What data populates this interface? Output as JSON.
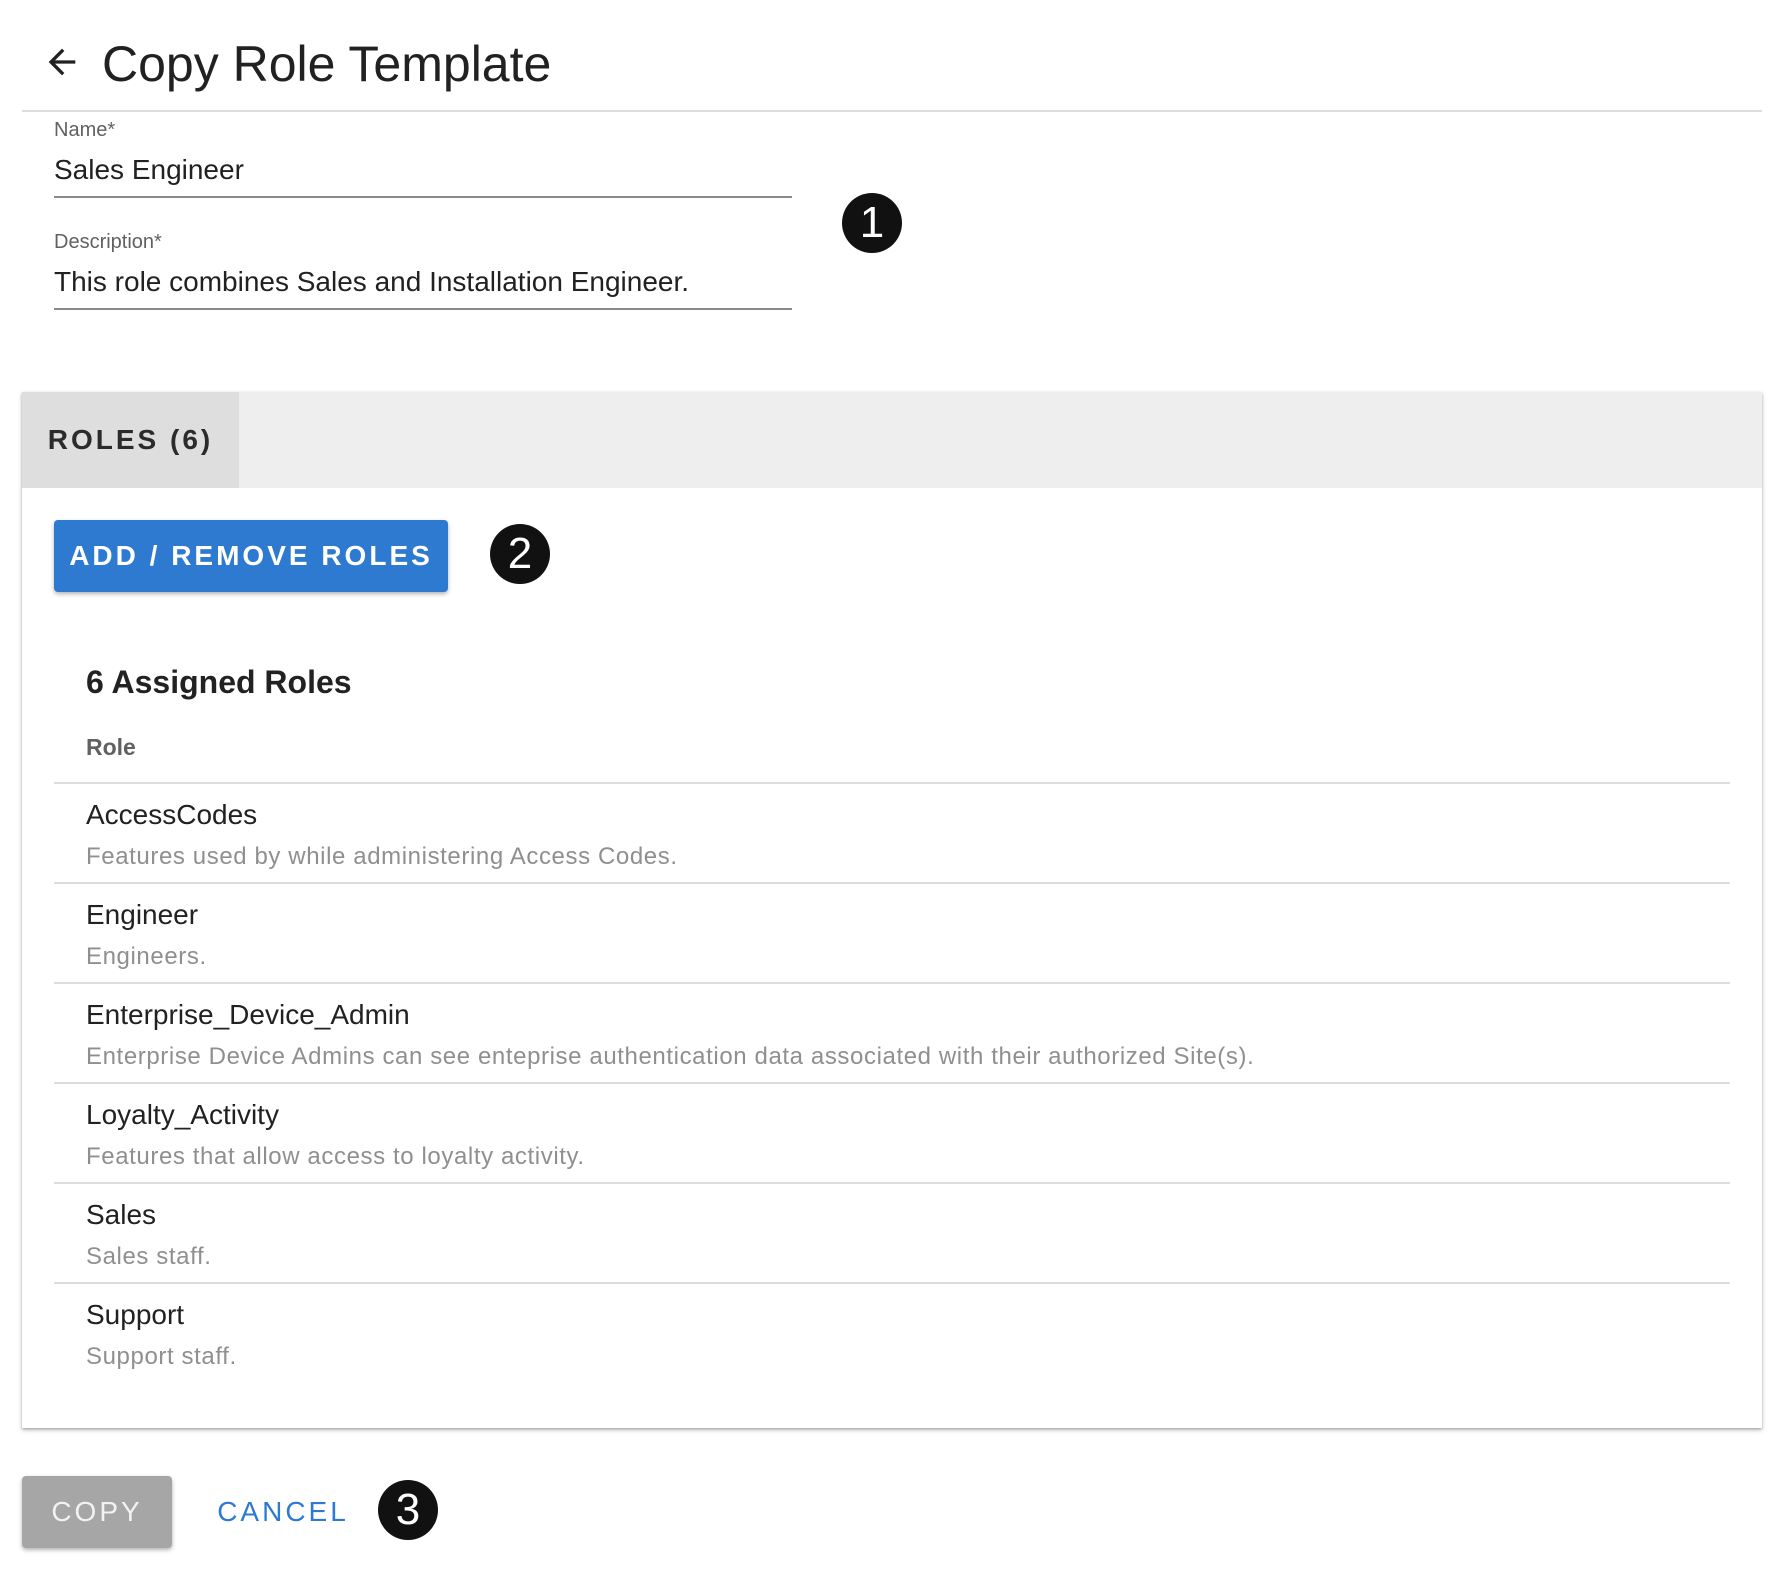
{
  "header": {
    "title": "Copy Role Template",
    "back_icon": "arrow-left-icon"
  },
  "form": {
    "name": {
      "label": "Name*",
      "value": "Sales Engineer"
    },
    "description": {
      "label": "Description*",
      "value": "This role combines Sales and Installation Engineer."
    }
  },
  "markers": [
    "1",
    "2",
    "3"
  ],
  "roles_card": {
    "tab_label": "ROLES (6)",
    "add_remove_label": "ADD / REMOVE ROLES",
    "assigned_heading": "6 Assigned Roles",
    "column_header": "Role",
    "roles": [
      {
        "name": "AccessCodes",
        "description": "Features used by while administering Access Codes."
      },
      {
        "name": "Engineer",
        "description": "Engineers."
      },
      {
        "name": "Enterprise_Device_Admin",
        "description": "Enterprise Device Admins can see enteprise authentication data associated with their authorized Site(s)."
      },
      {
        "name": "Loyalty_Activity",
        "description": "Features that allow access to loyalty activity."
      },
      {
        "name": "Sales",
        "description": "Sales staff."
      },
      {
        "name": "Support",
        "description": "Support staff."
      }
    ]
  },
  "footer": {
    "copy_label": "COPY",
    "cancel_label": "CANCEL"
  },
  "colors": {
    "primary": "#2e7ad1",
    "disabled_button": "#a6a6a6",
    "tab_bar": "#eeeeee",
    "marker": "#111111"
  }
}
